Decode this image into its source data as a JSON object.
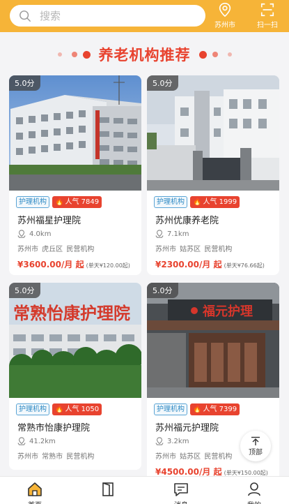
{
  "header": {
    "search_placeholder": "搜索",
    "location_label": "苏州市",
    "scan_label": "扫一扫"
  },
  "section": {
    "title": "养老机构推荐"
  },
  "cards": [
    {
      "score": "5.0分",
      "type": "护理机构",
      "popularity": "人气 7849",
      "name": "苏州福星护理院",
      "distance": "4.0km",
      "area": "苏州市 虎丘区 民营机构",
      "price": "¥3600.00/月 起",
      "daily": "(单天¥120.00起)"
    },
    {
      "score": "5.0分",
      "type": "护理机构",
      "popularity": "人气 1999",
      "name": "苏州优康养老院",
      "distance": "7.1km",
      "area": "苏州市 姑苏区 民营机构",
      "price": "¥2300.00/月 起",
      "daily": "(单天¥76.66起)"
    },
    {
      "score": "5.0分",
      "type": "护理机构",
      "popularity": "人气 1050",
      "name": "常熟市怡康护理院",
      "distance": "41.2km",
      "area": "苏州市 常熟市 民营机构",
      "price": "",
      "daily": ""
    },
    {
      "score": "5.0分",
      "type": "护理机构",
      "popularity": "人气 7399",
      "name": "苏州福元护理院",
      "distance": "3.2km",
      "area": "苏州市 姑苏区 民营机构",
      "price": "¥4500.00/月 起",
      "daily": "(单天¥150.00起)"
    }
  ],
  "signs": {
    "card3_sign": "常熟怡康护理院",
    "card4_sign": "福元护理"
  },
  "back_to_top": "顶部",
  "nav": {
    "home": "首页",
    "item2": "",
    "item3": "消息",
    "mine": "我的"
  },
  "colors": {
    "brand": "#f6b438",
    "accent": "#e8432f",
    "tag_blue": "#2d89c4"
  }
}
